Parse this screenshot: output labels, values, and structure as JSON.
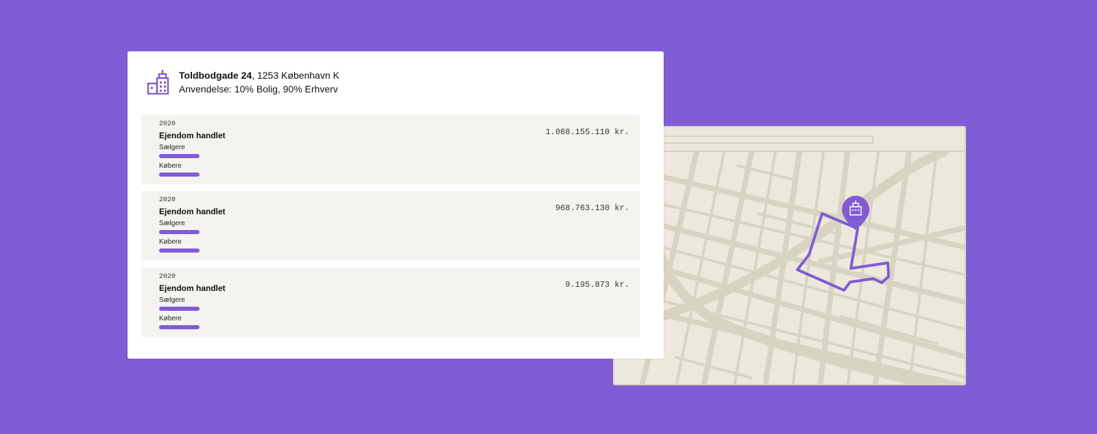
{
  "property": {
    "street": "Toldbodgade 24",
    "postal_city": ", 1253 København K",
    "usage": "Anvendelse: 10% Bolig, 90% Erhverv"
  },
  "transactions": [
    {
      "year": "2020",
      "title": "Ejendom handlet",
      "sellers_label": "Sælgere",
      "buyers_label": "Købere",
      "amount": "1.068.155.110 kr."
    },
    {
      "year": "2020",
      "title": "Ejendom handlet",
      "sellers_label": "Sælgere",
      "buyers_label": "Købere",
      "amount": "968.763.130 kr."
    },
    {
      "year": "2020",
      "title": "Ejendom handlet",
      "sellers_label": "Sælgere",
      "buyers_label": "Købere",
      "amount": "9.195.873 kr."
    }
  ],
  "colors": {
    "background": "#805cd5",
    "accent": "#805cd5",
    "map_base": "#ece8dc",
    "map_roads": "#d8d4c2"
  },
  "icons": {
    "header": "building-icon",
    "map_pin": "map-pin-building-icon"
  }
}
